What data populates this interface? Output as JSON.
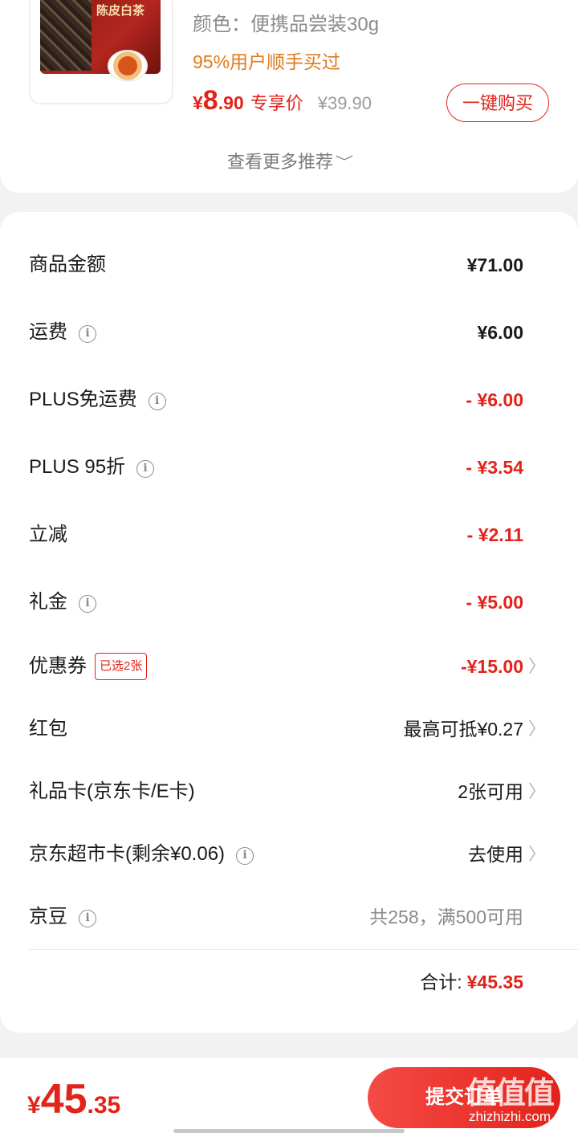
{
  "recommend": {
    "product_image_brand": "陈皮白茶",
    "spec": "颜色：便携品尝装30g",
    "bought": "95%用户顺手买过",
    "price_currency": "¥",
    "price_int": "8",
    "price_dec": ".90",
    "price_tag": "专享价",
    "price_old": "¥39.90",
    "buy_label": "一键购买",
    "more_label": "查看更多推荐"
  },
  "fees": {
    "goods": {
      "label": "商品金额",
      "value": "¥71.00"
    },
    "shipping": {
      "label": "运费",
      "value": "¥6.00"
    },
    "plus_free_ship": {
      "label": "PLUS免运费",
      "value": "- ¥6.00"
    },
    "plus_discount": {
      "label": "PLUS 95折",
      "value": "- ¥3.54"
    },
    "instant_cut": {
      "label": "立减",
      "value": "- ¥2.11"
    },
    "gift_money": {
      "label": "礼金",
      "value": "- ¥5.00"
    },
    "coupon": {
      "label": "优惠券",
      "badge": "已选2张",
      "value": "-¥15.00"
    },
    "red_packet": {
      "label": "红包",
      "value": "最高可抵¥0.27"
    },
    "gift_card": {
      "label": "礼品卡(京东卡/E卡)",
      "value": "2张可用"
    },
    "supermarket_card": {
      "label": "京东超市卡(剩余¥0.06)",
      "value": "去使用"
    },
    "jingdou": {
      "label": "京豆",
      "value": "共258，满500可用"
    },
    "total_label": "合计:",
    "total_value": "¥45.35"
  },
  "bottom": {
    "currency": "¥",
    "int": "45",
    "dec": ".35",
    "submit_label": "提交订单"
  },
  "watermark": {
    "big": "值值值",
    "small": "zhizhizhi.com"
  },
  "colors": {
    "accent": "#e2231a",
    "orange": "#e07a1a",
    "muted": "#8a8a8a"
  }
}
